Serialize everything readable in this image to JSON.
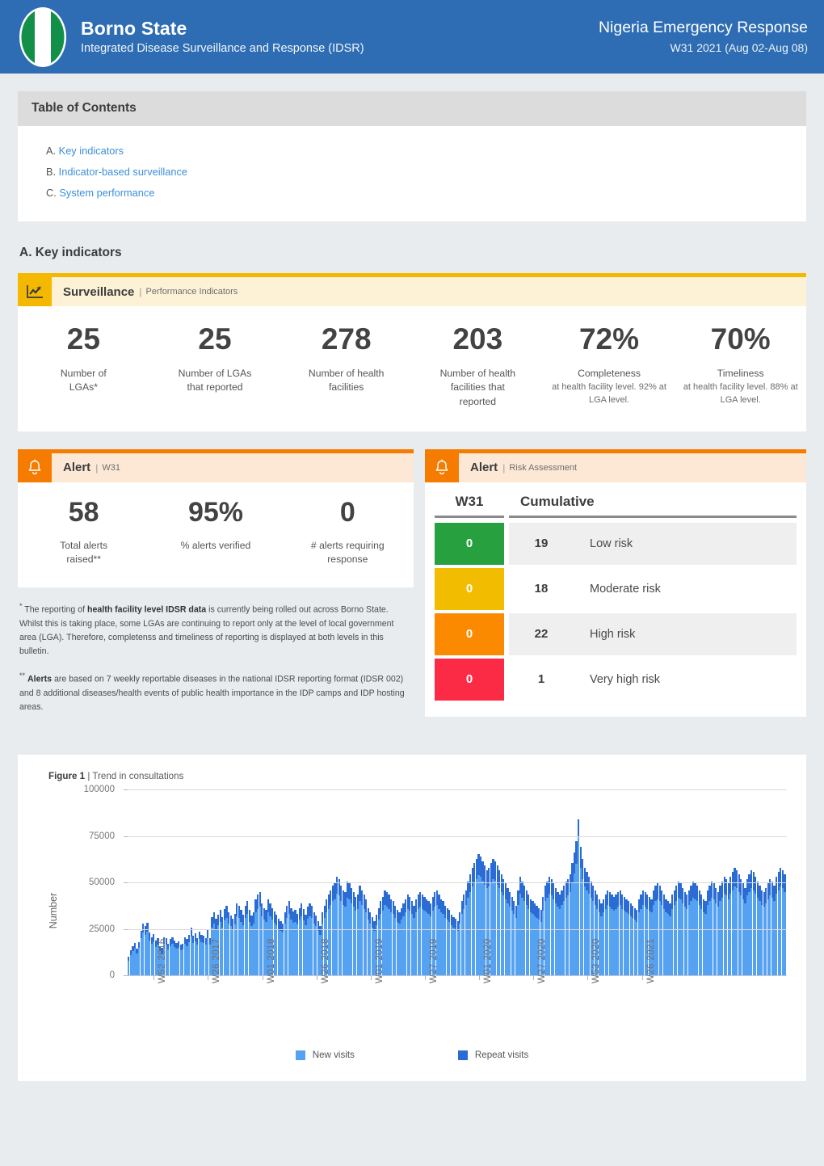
{
  "header": {
    "logo_icon": "nigeria-flag-icon",
    "state_title": "Borno State",
    "state_subtitle": "Integrated Disease Surveillance and Response (IDSR)",
    "response_title": "Nigeria Emergency Response",
    "response_week": "W31 2021 (Aug 02-Aug 08)",
    "bg_color": "#2e6db4"
  },
  "toc": {
    "title": "Table of Contents",
    "items": [
      {
        "marker": "A.",
        "label": "Key indicators"
      },
      {
        "marker": "B.",
        "label": "Indicator-based surveillance"
      },
      {
        "marker": "C.",
        "label": "System performance"
      }
    ]
  },
  "key_indicators": {
    "section_title": "A. Key indicators",
    "surveillance": {
      "icon": "trend-chart-icon",
      "name": "Surveillance",
      "separator": "|",
      "description": "Performance Indicators",
      "accent_color": "#f5b800",
      "band_color": "#fdf2d6",
      "kpis": [
        {
          "value": "25",
          "label": "Number of\nLGAs*",
          "note": ""
        },
        {
          "value": "25",
          "label": "Number of LGAs\nthat reported",
          "note": ""
        },
        {
          "value": "278",
          "label": "Number of health\nfacilities",
          "note": ""
        },
        {
          "value": "203",
          "label": "Number of health\nfacilities that\nreported",
          "note": ""
        },
        {
          "value": "72%",
          "label": "Completeness",
          "note": "at health facility level. 92% at LGA level."
        },
        {
          "value": "70%",
          "label": "Timeliness",
          "note": "at health facility level. 88% at LGA level."
        }
      ]
    },
    "alert_week": {
      "icon": "bell-icon",
      "name": "Alert",
      "separator": "|",
      "description": "W31",
      "accent_color": "#f57c00",
      "band_color": "#fde8d6",
      "kpis": [
        {
          "value": "58",
          "label": "Total alerts\nraised**"
        },
        {
          "value": "95%",
          "label": "% alerts verified"
        },
        {
          "value": "0",
          "label": "# alerts requiring\nresponse"
        }
      ]
    },
    "alert_risk": {
      "icon": "bell-icon",
      "name": "Alert",
      "separator": "|",
      "description": "Risk Assessment",
      "accent_color": "#f57c00",
      "band_color": "#fde8d6",
      "columns": [
        "W31",
        "Cumulative"
      ],
      "rows": [
        {
          "week": "0",
          "cumulative": "19",
          "label": "Low risk",
          "color": "#27a03f"
        },
        {
          "week": "0",
          "cumulative": "18",
          "label": "Moderate risk",
          "color": "#f2bc00"
        },
        {
          "week": "0",
          "cumulative": "22",
          "label": "High risk",
          "color": "#fc8a00"
        },
        {
          "week": "0",
          "cumulative": "1",
          "label": "Very high risk",
          "color": "#fb2a45"
        }
      ]
    },
    "footnotes": [
      {
        "marker": "*",
        "parts": [
          {
            "text": "The reporting of ",
            "bold": false
          },
          {
            "text": "health facility level IDSR data",
            "bold": true
          },
          {
            "text": " is currently being rolled out across Borno State. Whilst this is taking place, some LGAs are continuing to report only at the level of local government area (LGA). Therefore, completenss and timeliness of reporting is displayed at both levels in this bulletin.",
            "bold": false
          }
        ]
      },
      {
        "marker": "**",
        "parts": [
          {
            "text": "Alerts",
            "bold": true
          },
          {
            "text": " are based on 7 weekly reportable diseases in the national IDSR reporting format (IDSR 002) and 8 additional diseases/health events of public health importance in the IDP camps and IDP hosting areas.",
            "bold": false
          }
        ]
      }
    ]
  },
  "chart_data": {
    "type": "bar",
    "stacked": true,
    "figure_number": "Figure 1",
    "separator": "|",
    "title": "Trend in consultations",
    "xlabel": "",
    "ylabel": "Number",
    "ylim": [
      0,
      100000
    ],
    "yticks": [
      0,
      25000,
      50000,
      75000,
      100000
    ],
    "ytick_labels": [
      "0",
      "25000",
      "50000",
      "75000",
      "100000"
    ],
    "grid": true,
    "legend_position": "bottom",
    "legend": [
      {
        "name": "New visits",
        "color": "#56a2f2"
      },
      {
        "name": "Repeat visits",
        "color": "#2b6cd4"
      }
    ],
    "xtick_labels": [
      "W52 2016",
      "W26 2017",
      "W01 2018",
      "W26 2018",
      "W01 2019",
      "W27 2019",
      "W01 2020",
      "W27 2020",
      "W53 2020",
      "W26 2021"
    ],
    "xtick_positions": [
      12,
      38,
      64,
      90,
      116,
      142,
      168,
      194,
      220,
      246
    ],
    "series": [
      {
        "name": "New visits",
        "color": "#56a2f2",
        "values": [
          8000,
          11000,
          13000,
          14500,
          12000,
          15000,
          20000,
          23000,
          22000,
          23500,
          19000,
          17000,
          18500,
          15500,
          16500,
          13000,
          12000,
          17000,
          16500,
          14000,
          16000,
          17000,
          15500,
          14500,
          15000,
          13500,
          14000,
          17000,
          16000,
          18000,
          21000,
          17500,
          18500,
          16500,
          19500,
          18000,
          17500,
          16500,
          20000,
          16500,
          26000,
          28000,
          25000,
          27000,
          29000,
          26000,
          29500,
          31000,
          28000,
          26500,
          25000,
          27500,
          32000,
          31000,
          29000,
          27000,
          31000,
          33000,
          29000,
          26500,
          28000,
          34000,
          36000,
          37000,
          32000,
          30000,
          29000,
          34000,
          32000,
          30000,
          28500,
          27000,
          25000,
          24000,
          23000,
          28000,
          31000,
          33000,
          30000,
          28500,
          29000,
          27500,
          30000,
          32000,
          29500,
          27000,
          30500,
          32000,
          31000,
          28000,
          26500,
          24000,
          22000,
          28000,
          31000,
          34000,
          36000,
          38000,
          40000,
          41000,
          44000,
          43000,
          40000,
          38000,
          37000,
          42000,
          41000,
          39000,
          37000,
          35000,
          36000,
          40000,
          38000,
          36000,
          34000,
          30000,
          28000,
          26000,
          24000,
          27000,
          30000,
          33000,
          35000,
          38000,
          37000,
          36000,
          34000,
          33000,
          31000,
          29000,
          28000,
          30000,
          32000,
          34000,
          36000,
          35000,
          33000,
          31000,
          34000,
          36000,
          37000,
          36000,
          35000,
          34000,
          33000,
          32000,
          35000,
          37000,
          38000,
          36000,
          34000,
          33000,
          31000,
          30000,
          29000,
          27000,
          26000,
          25000,
          24000,
          28000,
          33000,
          36000,
          38000,
          42000,
          45000,
          48000,
          50000,
          52000,
          54000,
          53000,
          51000,
          49000,
          47000,
          48000,
          50000,
          52000,
          51000,
          49000,
          47000,
          45000,
          43000,
          41000,
          39000,
          37000,
          35000,
          33000,
          31000,
          38000,
          44000,
          42000,
          40000,
          38000,
          36000,
          34000,
          33000,
          32000,
          31000,
          30000,
          29000,
          35000,
          40000,
          42000,
          44000,
          43000,
          41000,
          39000,
          37000,
          36000,
          38000,
          40000,
          42000,
          43000,
          45000,
          50000,
          55000,
          60000,
          75000,
          58000,
          52000,
          48000,
          46000,
          44000,
          42000,
          40000,
          38000,
          36000,
          34000,
          32000,
          34000,
          36000,
          38000,
          37000,
          36000,
          35000,
          36000,
          37000,
          38000,
          36000,
          35000,
          34000,
          33000,
          32000,
          31000,
          30000,
          29000,
          34000,
          36000,
          38000,
          37000,
          36000,
          35000,
          34000,
          38000,
          40000,
          41000,
          40000,
          38000,
          36000,
          34000,
          33000,
          32000,
          36000,
          38000,
          40000,
          42000,
          41000,
          39000,
          37000,
          36000,
          38000,
          40000,
          42000,
          41000,
          40000,
          38000,
          36000,
          34000,
          33000,
          38000,
          40000,
          42000,
          41000,
          39000,
          37000,
          40000,
          42000,
          44000,
          43000,
          41000,
          44000,
          46000,
          48000,
          47000,
          45000,
          43000,
          41000,
          39000,
          43000,
          45000,
          47000,
          46000,
          44000,
          42000,
          40000,
          38000,
          37000,
          39000,
          41000,
          43000,
          42000,
          40000,
          44000,
          46000,
          48000,
          47000,
          45000
        ]
      },
      {
        "name": "Repeat visits",
        "color": "#2b6cd4",
        "values": [
          2000,
          2500,
          2800,
          3000,
          2500,
          3000,
          4000,
          5000,
          4800,
          5000,
          4200,
          3800,
          4000,
          3500,
          3600,
          3000,
          2800,
          3800,
          3600,
          3200,
          3500,
          3800,
          3500,
          3200,
          3300,
          3000,
          3100,
          3800,
          3600,
          4000,
          4600,
          3900,
          4100,
          3700,
          4300,
          4000,
          3900,
          3700,
          4400,
          3700,
          5500,
          6000,
          5400,
          5800,
          6200,
          5600,
          6300,
          6600,
          6000,
          5700,
          5400,
          5900,
          6800,
          6600,
          6200,
          5800,
          6600,
          7000,
          6200,
          5700,
          6000,
          7200,
          7600,
          7800,
          6800,
          6400,
          6200,
          7200,
          6800,
          6400,
          6100,
          5800,
          5400,
          5200,
          5000,
          6000,
          6600,
          7000,
          6400,
          6100,
          6200,
          5900,
          6400,
          6800,
          6300,
          5800,
          6500,
          6800,
          6600,
          6000,
          5700,
          5200,
          4800,
          6000,
          6600,
          7200,
          7600,
          8000,
          8400,
          8600,
          9200,
          9000,
          8400,
          8000,
          7800,
          8800,
          8600,
          8200,
          7800,
          7400,
          7600,
          8400,
          8000,
          7600,
          7200,
          6400,
          6000,
          5600,
          5200,
          5800,
          6400,
          7000,
          7400,
          8000,
          7800,
          7600,
          7200,
          7000,
          6600,
          6200,
          6000,
          6400,
          6800,
          7200,
          7600,
          7400,
          7000,
          6600,
          7200,
          7600,
          7800,
          7600,
          7400,
          7200,
          7000,
          6800,
          7400,
          7800,
          8000,
          7600,
          7200,
          7000,
          6600,
          6400,
          6200,
          5800,
          5600,
          5400,
          5200,
          6000,
          7000,
          7600,
          8000,
          8800,
          9400,
          10000,
          10400,
          10800,
          11200,
          11000,
          10600,
          10200,
          9800,
          10000,
          10400,
          10800,
          10600,
          10200,
          9800,
          9400,
          9000,
          8600,
          8200,
          7800,
          7400,
          7000,
          6600,
          8000,
          9200,
          8800,
          8400,
          8000,
          7600,
          7200,
          7000,
          6800,
          6600,
          6400,
          6200,
          7400,
          8400,
          8800,
          9200,
          9000,
          8600,
          8200,
          7800,
          7600,
          8000,
          8400,
          8800,
          9000,
          9400,
          10400,
          11400,
          12400,
          9000,
          11500,
          10800,
          10000,
          9600,
          9200,
          8800,
          8400,
          8000,
          7600,
          7200,
          6800,
          7200,
          7600,
          8000,
          7800,
          7600,
          7400,
          7600,
          7800,
          8000,
          7600,
          7400,
          7200,
          7000,
          6800,
          6600,
          6400,
          6200,
          7200,
          7600,
          8000,
          7800,
          7600,
          7400,
          7200,
          8000,
          8400,
          8600,
          8400,
          8000,
          7600,
          7200,
          7000,
          6800,
          7600,
          8000,
          8400,
          8800,
          8600,
          8200,
          7800,
          7600,
          8000,
          8400,
          8800,
          8600,
          8400,
          8000,
          7600,
          7200,
          7000,
          8000,
          8400,
          8800,
          8600,
          8200,
          7800,
          8400,
          8800,
          9200,
          9000,
          8600,
          9200,
          9600,
          10000,
          9800,
          9400,
          9000,
          8600,
          8200,
          9000,
          9400,
          9800,
          9600,
          9200,
          8800,
          8400,
          8000,
          7800,
          8200,
          8600,
          9000,
          8800,
          8400,
          9200,
          9600,
          10000,
          9800,
          9400
        ]
      }
    ]
  }
}
